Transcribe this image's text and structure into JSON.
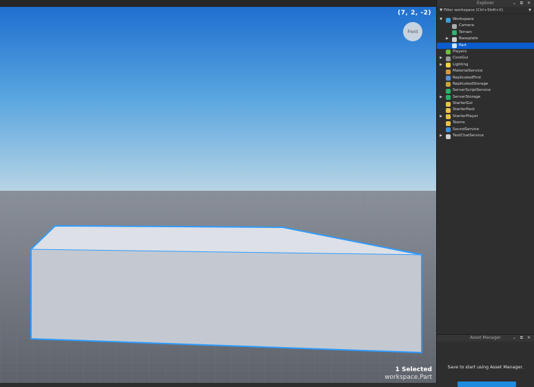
{
  "viewport": {
    "coords": "(7, 2, -2)",
    "viewcube_label": "Front",
    "selection_count": "1 Selected",
    "selection_path": "workspace.Part",
    "selection_color": "#2f9bff"
  },
  "explorer": {
    "title": "Explorer",
    "controls": "⌄ ⧉ ✕",
    "filter_placeholder": "Filter workspace (Ctrl+Shift+X)",
    "items": [
      {
        "label": "Workspace",
        "depth": 0,
        "arrow": "▼",
        "icon": "workspace-icon",
        "color": "#3aa0d8"
      },
      {
        "label": "Camera",
        "depth": 1,
        "arrow": "",
        "icon": "camera-icon",
        "color": "#aaaaaa"
      },
      {
        "label": "Terrain",
        "depth": 1,
        "arrow": "",
        "icon": "terrain-icon",
        "color": "#2fb36a"
      },
      {
        "label": "Baseplate",
        "depth": 1,
        "arrow": "▶",
        "icon": "part-icon",
        "color": "#cfcfcf"
      },
      {
        "label": "Part",
        "depth": 1,
        "arrow": "",
        "icon": "part-icon",
        "color": "#cfe4ff",
        "selected": true
      },
      {
        "label": "Players",
        "depth": 0,
        "arrow": "",
        "icon": "players-icon",
        "color": "#6fbf3a"
      },
      {
        "label": "CoreGui",
        "depth": 0,
        "arrow": "▶",
        "icon": "coregui-icon",
        "color": "#9a9a9a"
      },
      {
        "label": "Lighting",
        "depth": 0,
        "arrow": "▶",
        "icon": "lightbulb-icon",
        "color": "#f2d33a"
      },
      {
        "label": "MaterialService",
        "depth": 0,
        "arrow": "",
        "icon": "material-service-icon",
        "color": "#d79a3a"
      },
      {
        "label": "ReplicatedFirst",
        "depth": 0,
        "arrow": "",
        "icon": "replicated-first-icon",
        "color": "#5a8fd6"
      },
      {
        "label": "ReplicatedStorage",
        "depth": 0,
        "arrow": "",
        "icon": "replicated-storage-icon",
        "color": "#c9a53a"
      },
      {
        "label": "ServerScriptService",
        "depth": 0,
        "arrow": "",
        "icon": "server-script-service-icon",
        "color": "#27b46a"
      },
      {
        "label": "ServerStorage",
        "depth": 0,
        "arrow": "▶",
        "icon": "server-storage-icon",
        "color": "#27b46a"
      },
      {
        "label": "StarterGui",
        "depth": 0,
        "arrow": "",
        "icon": "starter-gui-icon",
        "color": "#e8c34a"
      },
      {
        "label": "StarterPack",
        "depth": 0,
        "arrow": "",
        "icon": "starter-pack-icon",
        "color": "#e8c34a"
      },
      {
        "label": "StarterPlayer",
        "depth": 0,
        "arrow": "▶",
        "icon": "starter-player-icon",
        "color": "#e8c34a"
      },
      {
        "label": "Teams",
        "depth": 0,
        "arrow": "",
        "icon": "teams-icon",
        "color": "#e8c34a"
      },
      {
        "label": "SoundService",
        "depth": 0,
        "arrow": "",
        "icon": "sound-service-icon",
        "color": "#3a8fe0"
      },
      {
        "label": "TextChatService",
        "depth": 0,
        "arrow": "▶",
        "icon": "text-chat-service-icon",
        "color": "#cfcfcf"
      }
    ]
  },
  "asset_manager": {
    "title": "Asset Manager",
    "controls": "⌄ ⧉ ✕",
    "message": "Save to start using Asset Manager."
  }
}
